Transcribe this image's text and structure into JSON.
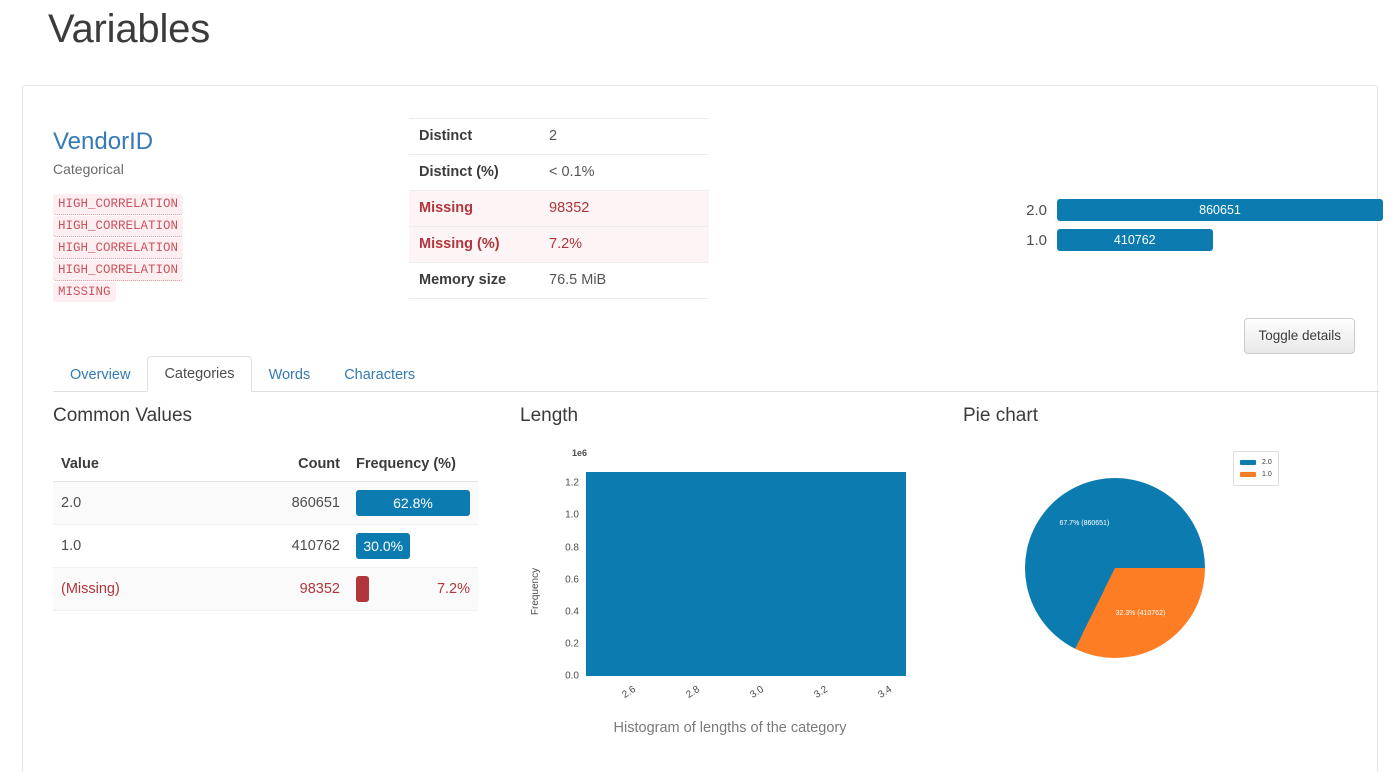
{
  "page": {
    "title": "Variables"
  },
  "variable": {
    "name": "VendorID",
    "type": "Categorical",
    "alerts": [
      {
        "label": "HIGH_CORRELATION"
      },
      {
        "label": "HIGH_CORRELATION"
      },
      {
        "label": "HIGH_CORRELATION"
      },
      {
        "label": "HIGH_CORRELATION"
      },
      {
        "label": "MISSING"
      }
    ],
    "stats": [
      {
        "label": "Distinct",
        "value": "2",
        "alert": false
      },
      {
        "label": "Distinct (%)",
        "value": "< 0.1%",
        "alert": false
      },
      {
        "label": "Missing",
        "value": "98352",
        "alert": true
      },
      {
        "label": "Missing (%)",
        "value": "7.2%",
        "alert": true
      },
      {
        "label": "Memory size",
        "value": "76.5 MiB",
        "alert": false
      }
    ],
    "toggle_details_label": "Toggle details"
  },
  "mini_bars": {
    "max": 860651,
    "rows": [
      {
        "label": "2.0",
        "value": "860651",
        "count": 860651
      },
      {
        "label": "1.0",
        "value": "410762",
        "count": 410762
      }
    ]
  },
  "tabs": [
    {
      "label": "Overview",
      "active": false
    },
    {
      "label": "Categories",
      "active": true
    },
    {
      "label": "Words",
      "active": false
    },
    {
      "label": "Characters",
      "active": false
    }
  ],
  "common_values": {
    "title": "Common Values",
    "headers": {
      "value": "Value",
      "count": "Count",
      "frequency": "Frequency (%)"
    },
    "rows": [
      {
        "value": "2.0",
        "count": "860651",
        "frequency": "62.8%",
        "pct": 62.8,
        "missing": false
      },
      {
        "value": "1.0",
        "count": "410762",
        "frequency": "30.0%",
        "pct": 30.0,
        "missing": false
      },
      {
        "value": "(Missing)",
        "count": "98352",
        "frequency": "7.2%",
        "pct": 7.2,
        "missing": true
      }
    ]
  },
  "length": {
    "title": "Length"
  },
  "pie": {
    "title": "Pie chart"
  },
  "colors": {
    "blue": "#0c7cb0",
    "orange": "#fc7d24",
    "red": "#b0363c",
    "link": "#337ab7"
  },
  "chart_data": [
    {
      "type": "bar",
      "name": "value-counts-mini",
      "orientation": "horizontal",
      "categories": [
        "2.0",
        "1.0"
      ],
      "values": [
        860651,
        410762
      ],
      "title": "",
      "xlabel": "",
      "ylabel": "",
      "grid": false,
      "legend": "none"
    },
    {
      "type": "bar",
      "name": "length-histogram",
      "title": "",
      "caption": "Histogram of lengths of the category",
      "xlabel": "",
      "ylabel": "Frequency",
      "y_exponent_label": "1e6",
      "yticks": [
        "0.0",
        "0.2",
        "0.4",
        "0.6",
        "0.8",
        "1.0",
        "1.2"
      ],
      "ytick_values": [
        0.0,
        0.2,
        0.4,
        0.6,
        0.8,
        1.0,
        1.2
      ],
      "ylim": [
        0,
        1.32
      ],
      "xticks": [
        "2.6",
        "2.8",
        "3.0",
        "3.2",
        "3.4"
      ],
      "xtick_values": [
        2.6,
        2.8,
        3.0,
        3.2,
        3.4
      ],
      "xlim": [
        2.5,
        3.5
      ],
      "bars": [
        {
          "x_left": 2.5,
          "x_right": 3.5,
          "value": 1.271
        }
      ],
      "grid": false,
      "legend": "none"
    },
    {
      "type": "pie",
      "name": "category-pie",
      "title": "",
      "labels": [
        "2.0",
        "1.0"
      ],
      "values": [
        860651,
        410762
      ],
      "percents": [
        67.7,
        32.3
      ],
      "slice_labels": [
        "67.7%  (860651)",
        "32.3%  (410762)"
      ],
      "colors": [
        "#0c7cb0",
        "#fc7d24"
      ],
      "legend": "upper right",
      "legend_entries": [
        "2.0",
        "1.0"
      ]
    }
  ]
}
